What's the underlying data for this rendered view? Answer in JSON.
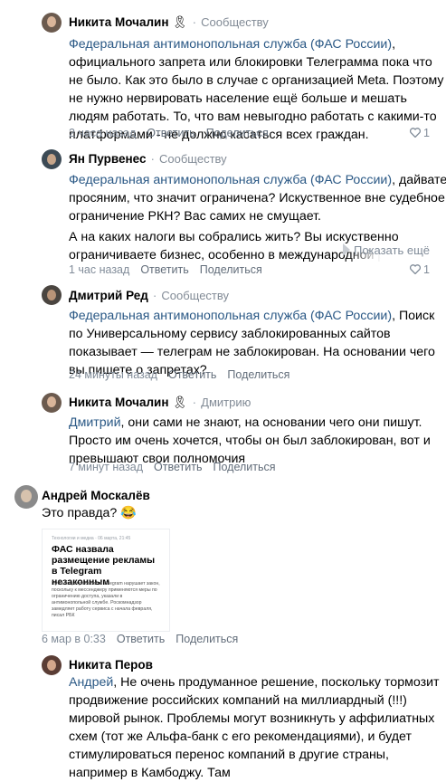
{
  "comments": [
    {
      "author": "Никита Мочалин",
      "target": "Сообществу",
      "link": "Федеральная антимонопольная служба (ФАС России)",
      "body": ", официального запрета или блокировки Телеграмма пока что не было. Как это было в случае с организацией Meta. Поэтому не нужно нервировать население ещё больше и мешать людям работать. То, что вам невыгодно работать с какими-то платформами - не должно касаться всех граждан.",
      "time": "2 часа назад",
      "reply": "Ответить",
      "share": "Поделиться",
      "likes": "1"
    },
    {
      "author": "Ян Пурвенес",
      "target": "Сообществу",
      "link": "Федеральная антимонопольная служба (ФАС России)",
      "body": ", дайвате просяним, что значит ограничена? Искуственное вне судебное ограничение РКН? Вас самих не смущает.",
      "body2": "А на каких налоги вы собрались жить? Вы искуственно ограничиваете бизнес, особенно в международной р",
      "more": "Показать ещё",
      "time": "1 час назад",
      "reply": "Ответить",
      "share": "Поделиться",
      "likes": "1"
    },
    {
      "author": "Дмитрий Ред",
      "target": "Сообществу",
      "link": "Федеральная антимонопольная служба (ФАС России)",
      "body": ", Поиск по Универсальному сервису заблокированных сайтов показывает — телеграм не заблокирован. На основании чего вы пишете о запретах?",
      "time": "24 минуты назад",
      "reply": "Ответить",
      "share": "Поделиться"
    },
    {
      "author": "Никита Мочалин",
      "target": "Дмитрию",
      "link": "Дмитрий",
      "body": ", они сами не знают, на основании чего они пишут. Просто им очень хочется, чтобы он был заблокирован, вот и превышают свои полномочия",
      "time": "7 минут назад",
      "reply": "Ответить",
      "share": "Поделиться"
    },
    {
      "author": "Андрей Москалёв",
      "body": "Это правда? 😂",
      "time": "6 мар в 0:33",
      "reply": "Ответить",
      "share": "Поделиться",
      "attachment": {
        "source": "Технологии и медиа · 06 марта, 21:45",
        "headline": "ФАС назвала размещение рекламы в Telegram незаконным",
        "text": "Публикация рекламы в Telegram нарушает закон, поскольку к мессенджеру применяются меры по ограничению доступа, указали в антимонопольной службе. Роскомнадзор замедляет работу сервиса с начала февраля, писал РБК"
      }
    },
    {
      "author": "Никита Перов",
      "link": "Андрей",
      "body": ", Не очень продуманное решение, поскольку тормозит продвижение российских компаний на миллиардный (!!!) мировой рынок. Проблемы могут возникнуть у аффилиатных схем (тот же Альфа-банк с его рекомендациями), и будет стимулироваться перенос компаний в другие страны, например в Камбоджу. Там"
    }
  ],
  "colors": {
    "link": "#2a5885",
    "meta": "#818c99",
    "action": "#626d7a"
  }
}
